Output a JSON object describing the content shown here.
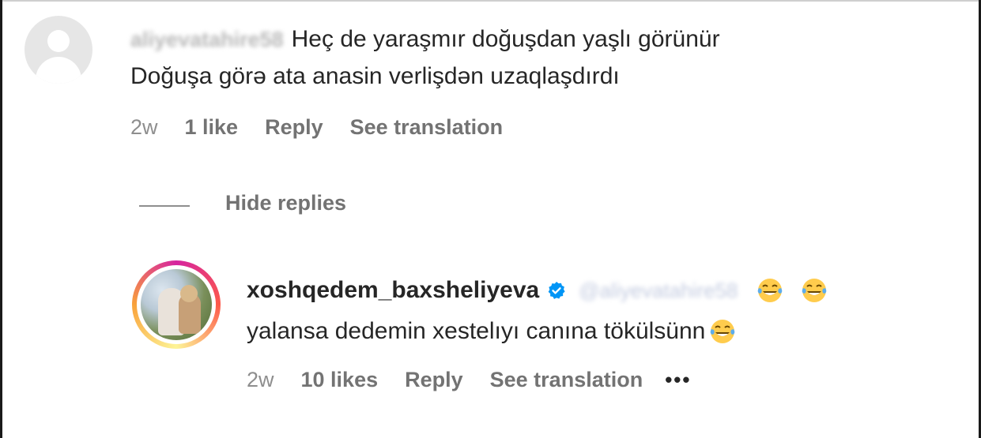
{
  "comment": {
    "username": "aliyevatahire58",
    "text_line1": "Heç de yaraşmır doğuşdan yaşlı görünür",
    "text_line2": "Doğuşa görə ata anasin verlişdən uzaqlaşdırdı",
    "time": "2w",
    "likes": "1 like",
    "reply_label": "Reply",
    "translate_label": "See translation",
    "avatar_icon": "default-avatar-icon"
  },
  "hide_replies_label": "Hide replies",
  "reply": {
    "username": "xoshqedem_baxsheliyeva",
    "verified": true,
    "mention": "@aliyevatahire58",
    "text": "yalansa dedemin xestelıyı canına tökülsünn",
    "time": "2w",
    "likes": "10 likes",
    "reply_label": "Reply",
    "translate_label": "See translation",
    "more_label": "•••",
    "emoji_icon": "face-with-tears-of-joy-icon"
  },
  "colors": {
    "text": "#262626",
    "meta": "#8e8e8e",
    "verified_blue": "#0095f6",
    "emoji_yellow": "#ffcc4d"
  }
}
